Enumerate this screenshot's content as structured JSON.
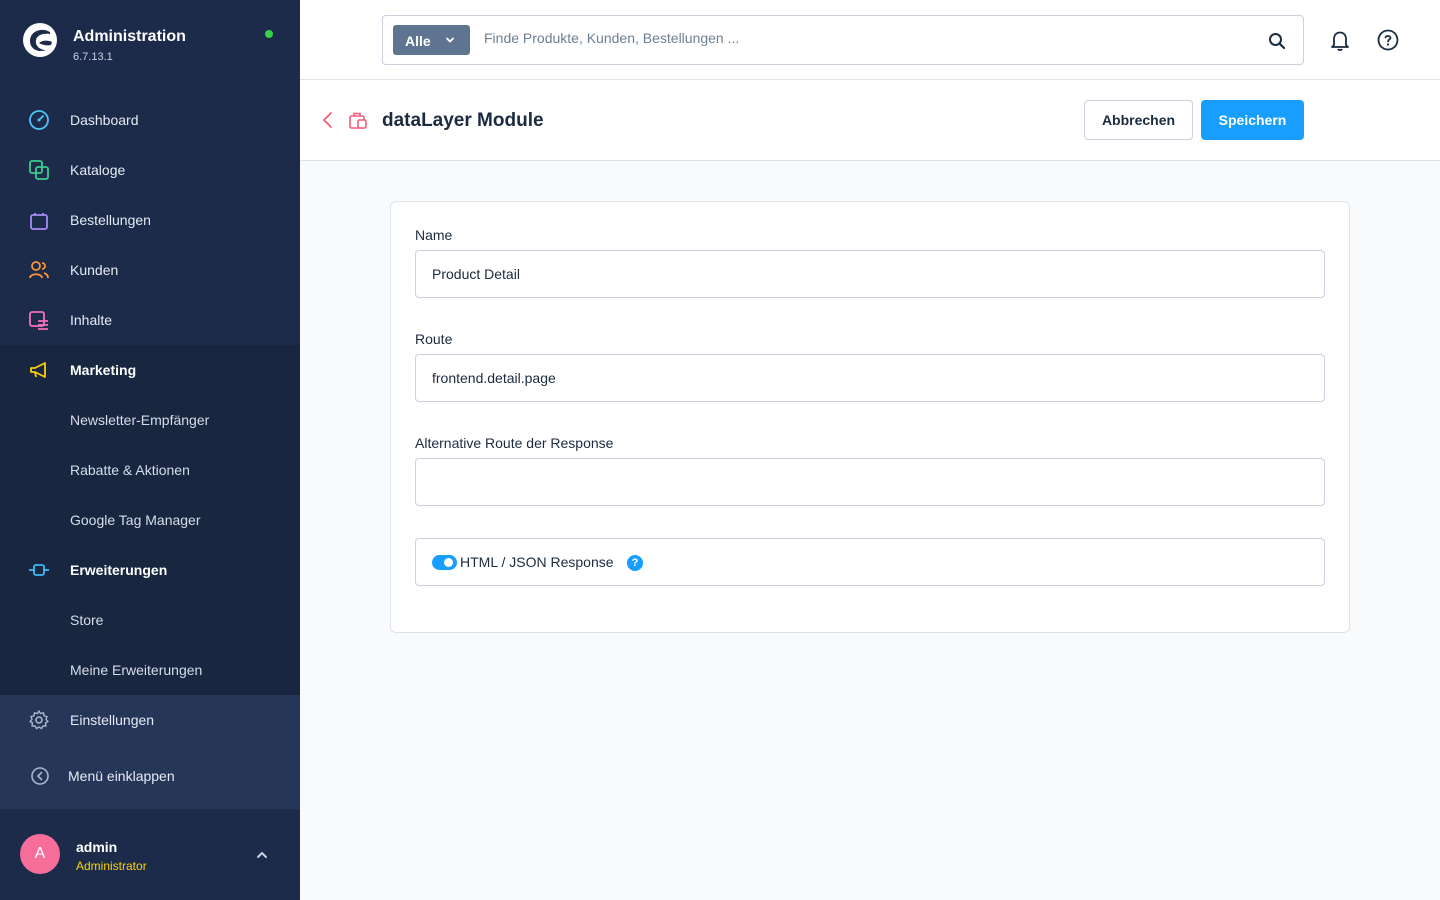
{
  "app": {
    "title": "Administration",
    "version": "6.7.13.1"
  },
  "sidebar": {
    "items": [
      {
        "label": "Dashboard",
        "icon": "dashboard-icon"
      },
      {
        "label": "Kataloge",
        "icon": "catalog-icon"
      },
      {
        "label": "Bestellungen",
        "icon": "shopping-bag-icon"
      },
      {
        "label": "Kunden",
        "icon": "users-icon"
      },
      {
        "label": "Inhalte",
        "icon": "content-icon"
      },
      {
        "label": "Marketing",
        "icon": "megaphone-icon"
      },
      {
        "label": "Newsletter-Empfänger"
      },
      {
        "label": "Rabatte & Aktionen"
      },
      {
        "label": "Google Tag Manager"
      },
      {
        "label": "Erweiterungen",
        "icon": "plug-icon"
      },
      {
        "label": "Store"
      },
      {
        "label": "Meine Erweiterungen"
      },
      {
        "label": "Einstellungen",
        "icon": "gear-icon"
      }
    ],
    "collapse_label": "Menü einklappen",
    "user": {
      "initial": "A",
      "name": "admin",
      "role": "Administrator"
    }
  },
  "search": {
    "type_label": "Alle",
    "placeholder": "Finde Produkte, Kunden, Bestellungen ..."
  },
  "smartbar": {
    "title": "dataLayer Module",
    "cancel_label": "Abbrechen",
    "save_label": "Speichern"
  },
  "form": {
    "name_label": "Name",
    "name_value": "Product Detail",
    "route_label": "Route",
    "route_value": "frontend.detail.page",
    "alt_route_label": "Alternative Route der Response",
    "alt_route_value": "",
    "toggle_label": "HTML / JSON Response",
    "toggle_on": true,
    "info_glyph": "?"
  },
  "colors": {
    "sidebar_bg": "#1c2b4a",
    "accent": "#189eff",
    "status_online": "#37d046",
    "avatar": "#f66d99",
    "role": "#ffd200"
  }
}
